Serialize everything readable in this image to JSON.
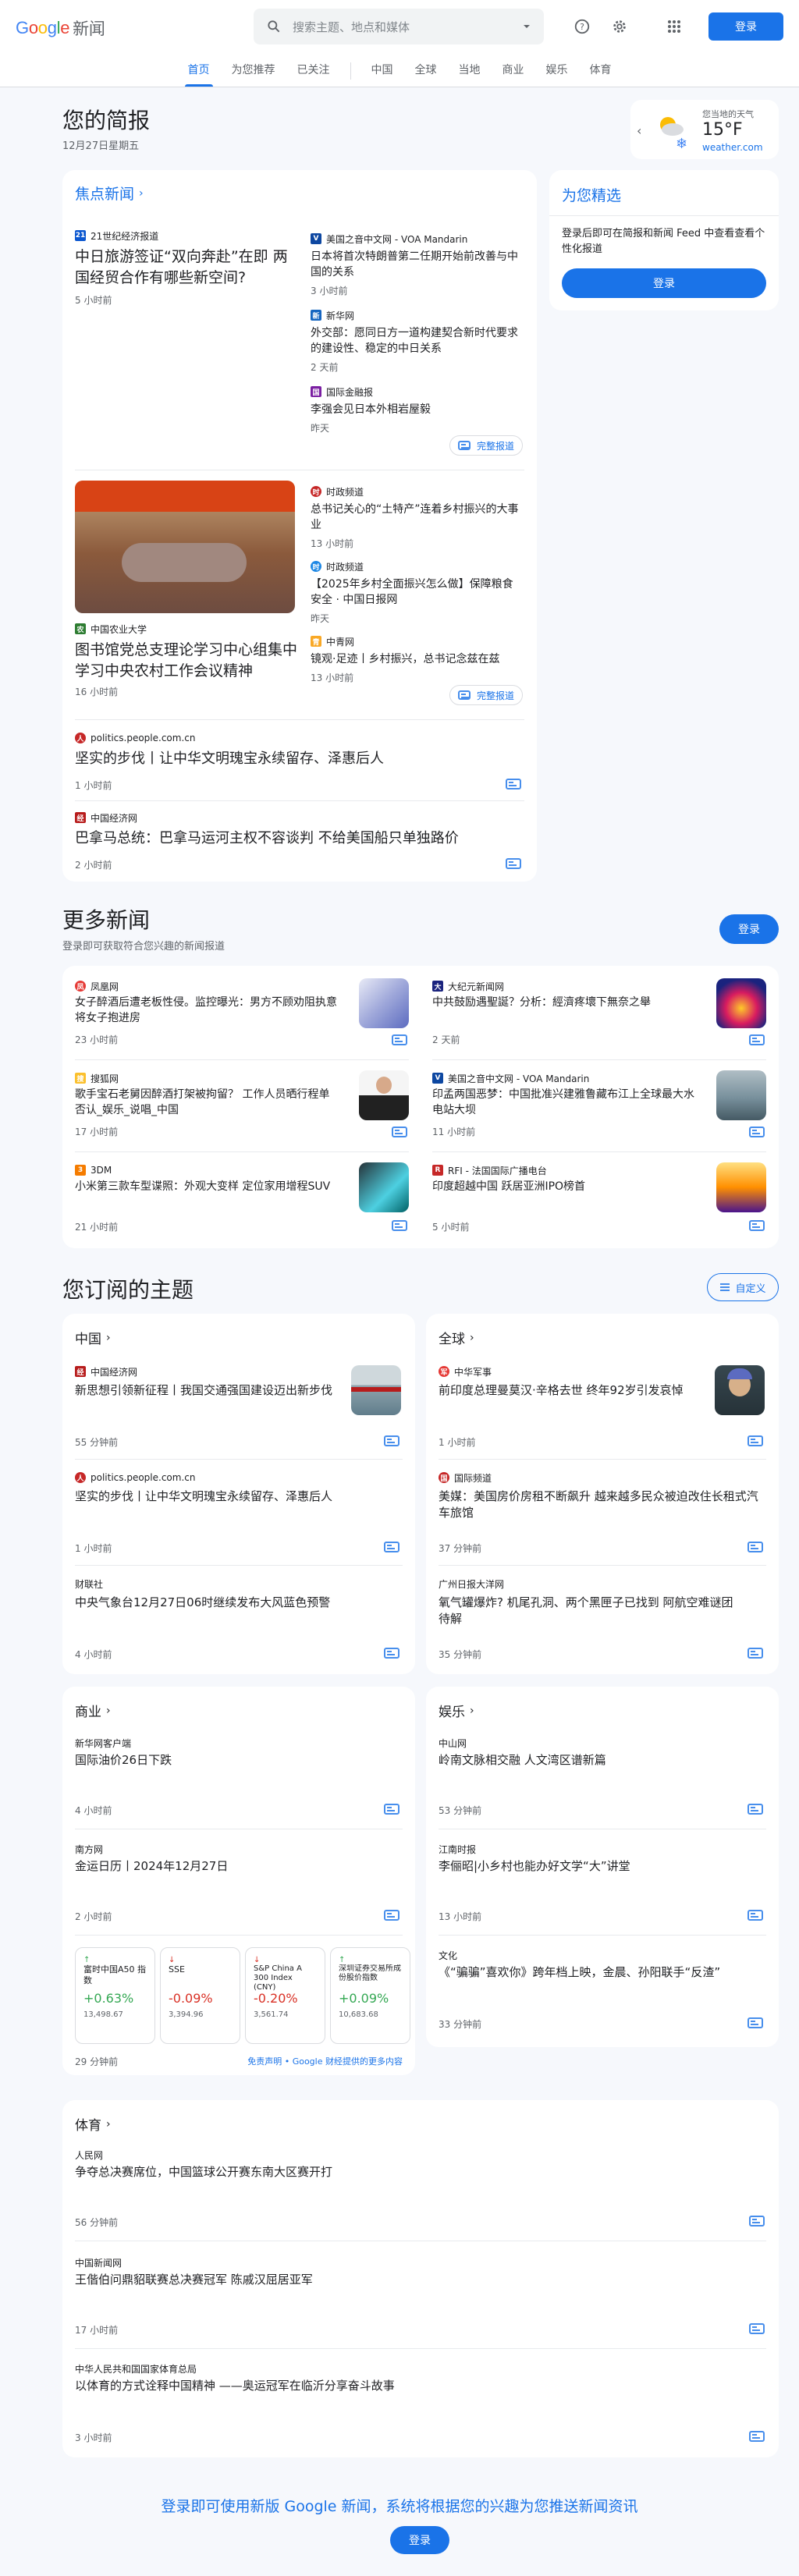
{
  "header": {
    "logo_google": "Google",
    "logo_news": "新闻",
    "search_placeholder": "搜索主题、地点和媒体",
    "signin": "登录"
  },
  "nav": [
    "首页",
    "为您推荐",
    "已关注",
    "中国",
    "全球",
    "当地",
    "商业",
    "娱乐",
    "体育"
  ],
  "briefing": {
    "title": "您的简报",
    "date": "12月27日星期五"
  },
  "weather": {
    "label": "您当地的天气",
    "temp": "15°F",
    "source": "weather.com"
  },
  "top": {
    "title": "焦点新闻",
    "c1": {
      "src": "21世纪经济报道",
      "title": "中日旅游签证“双向奔赴”在即 两国经贸合作有哪些新空间?",
      "time": "5 小时前",
      "r": [
        {
          "src": "美国之音中文网 - VOA Mandarin",
          "title": "日本将首次特朗普第二任期开始前改善与中国的关系",
          "time": "3 小时前"
        },
        {
          "src": "新华网",
          "title": "外交部：愿同日方一道构建契合新时代要求的建设性、稳定的中日关系",
          "time": "2 天前"
        },
        {
          "src": "国际金融报",
          "title": "李强会见日本外相岩屋毅",
          "time": "昨天"
        }
      ]
    },
    "c2": {
      "src": "中国农业大学",
      "title": "图书馆党总支理论学习中心组集中学习中央农村工作会议精神",
      "time": "16 小时前",
      "r": [
        {
          "src": "时政频道",
          "title": "总书记关心的“土特产”连着乡村振兴的大事业",
          "time": "13 小时前"
        },
        {
          "src": "时政频道",
          "title": "【2025年乡村全面振兴怎么做】保障粮食安全 · 中国日报网",
          "time": "昨天"
        },
        {
          "src": "中青网",
          "title": "镜观·足迹丨乡村振兴，总书记念兹在兹",
          "time": "13 小时前"
        }
      ]
    },
    "s1": {
      "src": "politics.people.com.cn",
      "title": "坚实的步伐丨让中华文明瑰宝永续留存、泽惠后人",
      "time": "1 小时前"
    },
    "s2": {
      "src": "中国经济网",
      "title": "巴拿马总统：巴拿马运河主权不容谈判 不给美国船只单独路价",
      "time": "2 小时前"
    },
    "coverage": "完整报道"
  },
  "picks": {
    "title": "为您精选",
    "desc": "登录后即可在简报和新闻 Feed 中查看查看个性化报道",
    "signin": "登录"
  },
  "more": {
    "title": "更多新闻",
    "sub": "登录即可获取符合您兴趣的新闻报道",
    "signin": "登录",
    "items": [
      {
        "src": "凤凰网",
        "title": "女子醉酒后遭老板性侵。监控曝光：男方不顾劝阻执意将女子抱进房",
        "time": "23 小时前"
      },
      {
        "src": "大纪元新闻网",
        "title": "中共鼓励遇聖誕？分析：經濟疼壞下無奈之舉",
        "time": "2 天前"
      },
      {
        "src": "搜狐网",
        "title": "歌手宝石老舅因醉酒打架被拘留？ 工作人员晒行程单否认_娱乐_说唱_中国",
        "time": "17 小时前"
      },
      {
        "src": "美国之音中文网 - VOA Mandarin",
        "title": "印孟两国恶梦：中国批准兴建雅鲁藏布江上全球最大水电站大坝",
        "time": "11 小时前"
      },
      {
        "src": "3DM",
        "title": "小米第三款车型谍照：外观大变样 定位家用增程SUV",
        "time": "21 小时前"
      },
      {
        "src": "RFI - 法国国际广播电台",
        "title": "印度超越中国 跃居亚洲IPO榜首",
        "time": "5 小时前"
      }
    ]
  },
  "topics": {
    "title": "您订阅的主题",
    "customize": "自定义",
    "china": {
      "title": "中国",
      "items": [
        {
          "src": "中国经济网",
          "title": "新思想引领新征程丨我国交通强国建设迈出新步伐",
          "time": "55 分钟前"
        },
        {
          "src": "politics.people.com.cn",
          "title": "坚实的步伐丨让中华文明瑰宝永续留存、泽惠后人",
          "time": "1 小时前"
        },
        {
          "src": "财联社",
          "title": "中央气象台12月27日06时继续发布大风蓝色预警",
          "time": "4 小时前"
        }
      ]
    },
    "world": {
      "title": "全球",
      "items": [
        {
          "src": "中华军事",
          "title": "前印度总理曼莫汉·辛格去世 终年92岁引发哀悼",
          "time": "1 小时前"
        },
        {
          "src": "国际频道",
          "title": "美媒：美国房价房租不断飙升 越来越多民众被迫改住长租式汽车旅馆",
          "time": "37 分钟前"
        },
        {
          "src": "广州日报大洋网",
          "title": "氧气罐爆炸? 机尾孔洞、两个黑匣子已找到 阿航空难谜团待解",
          "time": "35 分钟前"
        }
      ]
    },
    "business": {
      "title": "商业",
      "items": [
        {
          "src": "新华网客户端",
          "title": "国际油价26日下跌",
          "time": "4 小时前"
        },
        {
          "src": "南方网",
          "title": "金运日历丨2024年12月27日",
          "time": "2 小时前"
        }
      ],
      "stocks": [
        {
          "name": "富时中国A50 指数",
          "pct": "+0.63%",
          "val": "13,498.67",
          "dir": "up"
        },
        {
          "name": "SSE",
          "pct": "-0.09%",
          "val": "3,394.96",
          "dir": "down"
        },
        {
          "name": "S&P China A 300 Index (CNY)",
          "pct": "-0.20%",
          "val": "3,561.74",
          "dir": "down"
        },
        {
          "name": "深圳证券交易所成份股价指数",
          "pct": "+0.09%",
          "val": "10,683.68",
          "dir": "up"
        }
      ],
      "time": "29 分钟前",
      "disclaimer": "免责声明 • Google 财经提供的更多内容"
    },
    "ent": {
      "title": "娱乐",
      "items": [
        {
          "src": "中山网",
          "title": "岭南文脉相交融 人文湾区谱新篇",
          "time": "53 分钟前"
        },
        {
          "src": "江南时报",
          "title": "李俪昭|小乡村也能办好文学“大”讲堂",
          "time": "13 小时前"
        },
        {
          "src": "文化",
          "title": "《“骗骗”喜欢你》跨年档上映，金晨、孙阳联手“反渣”",
          "time": "33 分钟前"
        }
      ]
    },
    "sports": {
      "title": "体育",
      "items": [
        {
          "src": "人民网",
          "title": "争夺总决赛席位，中国篮球公开赛东南大区赛开打",
          "time": "56 分钟前"
        },
        {
          "src": "中国新闻网",
          "title": "王偕伯问鼎貂联赛总决赛冠军 陈戚汉屈居亚军",
          "time": "17 小时前"
        },
        {
          "src": "中华人民共和国国家体育总局",
          "title": "以体育的方式诠释中国精神 ——奥运冠军在临沂分享奋斗故事",
          "time": "3 小时前"
        }
      ]
    }
  },
  "footer": {
    "text": "登录即可使用新版 Google 新闻，系统将根据您的兴趣为您推送新闻资讯",
    "signin": "登录"
  }
}
